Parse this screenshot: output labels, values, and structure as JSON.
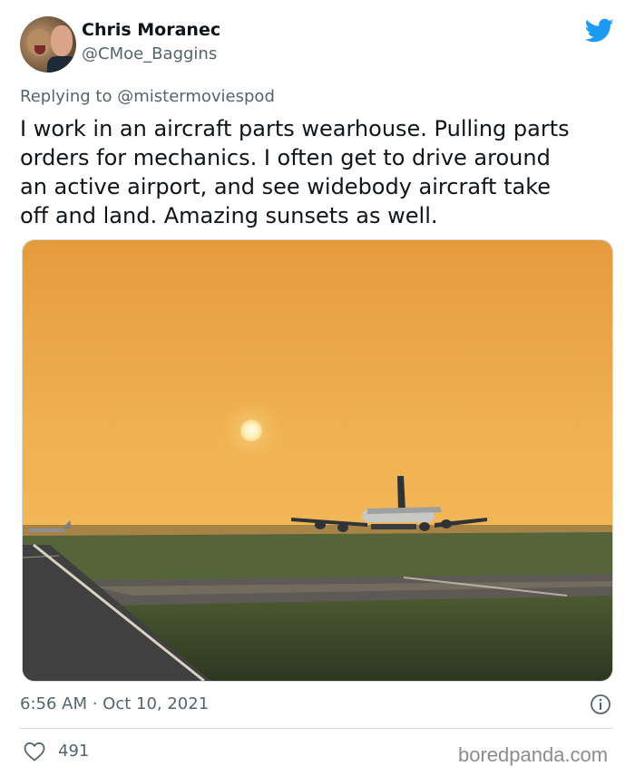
{
  "author": {
    "name": "Chris Moranec",
    "handle": "@CMoe_Baggins"
  },
  "reply": {
    "prefix": "Replying to",
    "mention": "@mistermoviespod"
  },
  "tweet": {
    "lines": [
      "I work in an aircraft parts wearhouse. Pulling parts",
      "orders for mechanics. I often get to drive around",
      "an active airport, and see widebody aircraft take",
      "off and land. Amazing sunsets as well."
    ],
    "timestamp": "6:56 AM · Oct 10, 2021",
    "like_count": "491"
  },
  "photo": {
    "icon": "sunset-airplane-photo"
  },
  "icons": {
    "brand": "bird-icon",
    "info": "info-icon",
    "like": "heart-icon"
  },
  "colors": {
    "twitter_blue": "#1d9bf0",
    "secondary_text": "#536471",
    "sky": "#f0b251"
  },
  "watermark": "boredpanda.com"
}
